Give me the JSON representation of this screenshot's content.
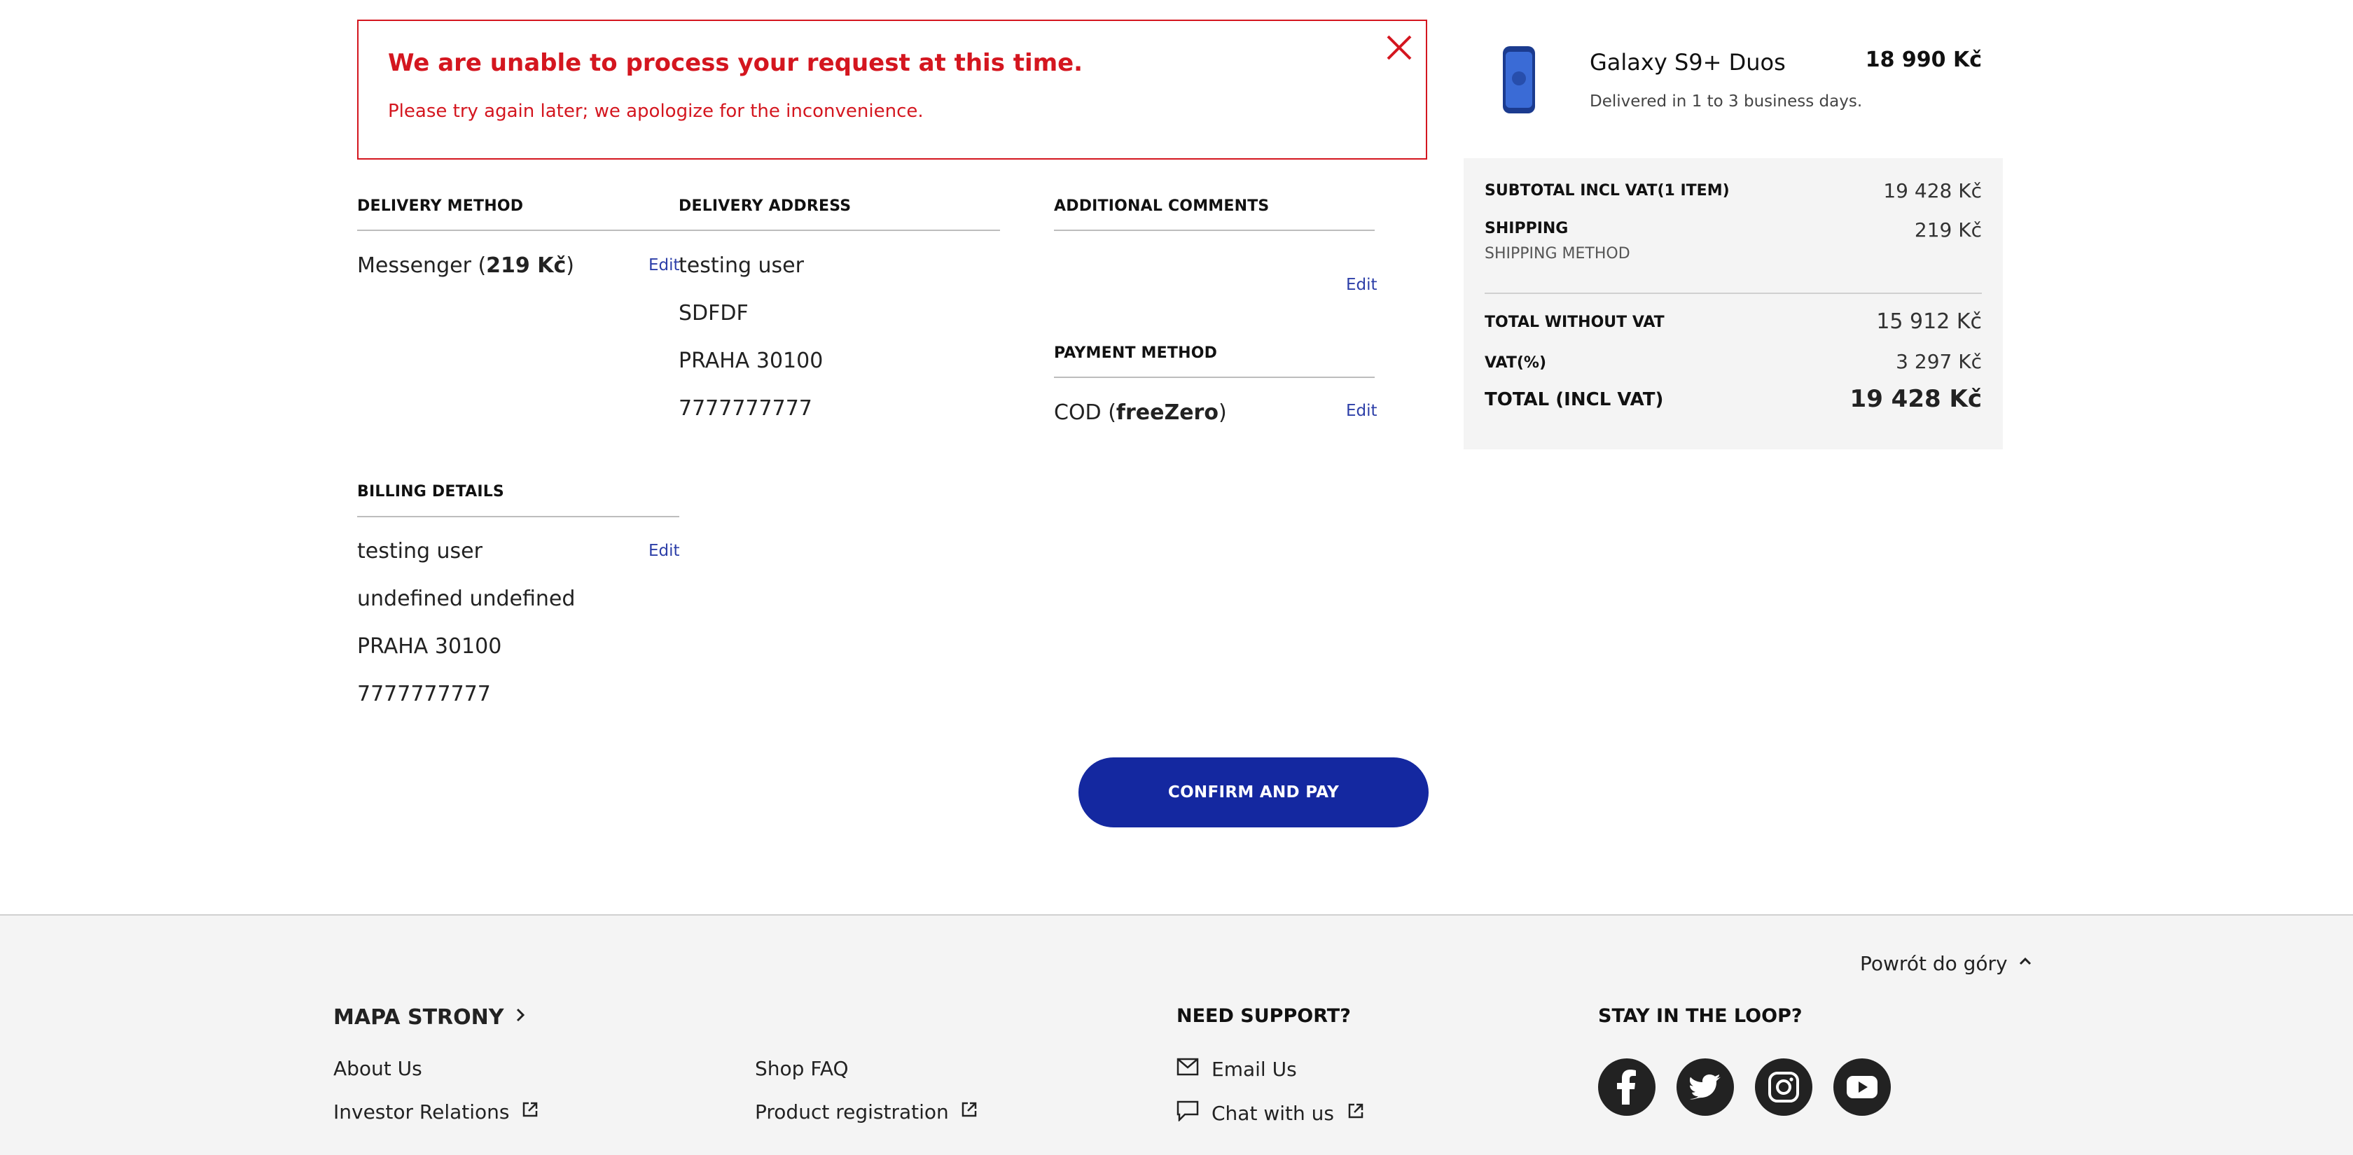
{
  "error": {
    "title": "We are unable to process your request at this time.",
    "message": "Please try again later; we apologize for the inconvenience."
  },
  "delivery_method": {
    "heading": "DELIVERY METHOD",
    "value_prefix": "Messenger (",
    "value_bold": "219 Kč",
    "value_suffix": ")",
    "edit": "Edit"
  },
  "delivery_address": {
    "heading": "DELIVERY ADDRESS",
    "lines": [
      "testing user",
      "SDFDF",
      "PRAHA 30100",
      "7777777777"
    ],
    "edit": "Edit"
  },
  "additional_comments": {
    "heading": "ADDITIONAL COMMENTS",
    "edit": "Edit"
  },
  "payment_method": {
    "heading": "PAYMENT METHOD",
    "value_prefix": "COD (",
    "value_bold": "freeZero",
    "value_suffix": ")",
    "edit": "Edit"
  },
  "billing_details": {
    "heading": "BILLING DETAILS",
    "lines": [
      "testing user",
      "undefined undefined",
      "PRAHA 30100",
      "7777777777"
    ],
    "edit": "Edit"
  },
  "confirm_label": "CONFIRM AND PAY",
  "product": {
    "name": "Galaxy S9+ Duos",
    "delivery": "Delivered in 1 to 3 business days.",
    "price": "18 990 Kč"
  },
  "summary": {
    "subtotal_label": "SUBTOTAL INCL VAT(1 ITEM)",
    "subtotal_value": "19 428 Kč",
    "shipping_label": "SHIPPING",
    "shipping_sub": "SHIPPING METHOD",
    "shipping_value": "219 Kč",
    "total_wo_vat_label": "TOTAL WITHOUT VAT",
    "total_wo_vat_value": "15 912 Kč",
    "vat_label": "VAT(%)",
    "vat_value": "3 297 Kč",
    "total_label": "TOTAL (INCL VAT)",
    "total_value": "19 428 Kč"
  },
  "footer": {
    "back_to_top": "Powrót do góry",
    "sitemap": "MAPA STRONY",
    "col1": [
      "About Us",
      "Investor Relations"
    ],
    "col2": [
      "Shop FAQ",
      "Product registration"
    ],
    "support_heading": "NEED SUPPORT?",
    "support": [
      "Email Us",
      "Chat with us"
    ],
    "loop_heading": "STAY IN THE LOOP?"
  },
  "colors": {
    "accent": "#1428a0",
    "error": "#d4161f"
  }
}
